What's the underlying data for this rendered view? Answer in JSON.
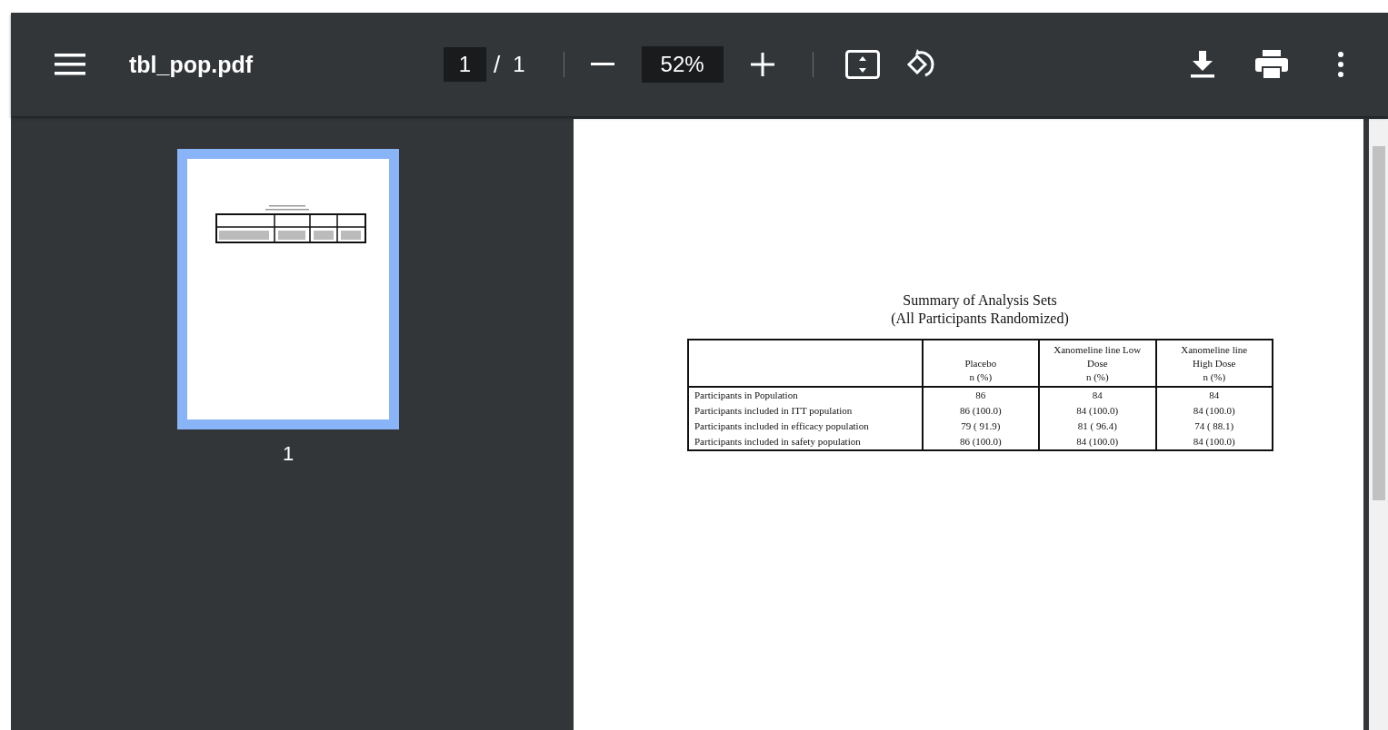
{
  "toolbar": {
    "title": "tbl_pop.pdf",
    "page_current": "1",
    "page_separator": "/",
    "page_total": "1",
    "zoom": "52%"
  },
  "sidebar": {
    "thumbnails": [
      {
        "label": "1",
        "selected": true
      }
    ]
  },
  "document": {
    "title_lines": [
      "Summary of Analysis Sets",
      "(All Participants Randomized)"
    ],
    "table": {
      "columns": [
        {
          "lines": [
            "Placebo",
            "n (%)"
          ]
        },
        {
          "lines": [
            "Xanomeline line Low",
            "Dose",
            "n (%)"
          ]
        },
        {
          "lines": [
            "Xanomeline line",
            "High Dose",
            "n (%)"
          ]
        }
      ],
      "rows": [
        {
          "label": "Participants in Population",
          "cells": [
            "86",
            "84",
            "84"
          ]
        },
        {
          "label": "Participants included in ITT population",
          "cells": [
            "86 (100.0)",
            "84 (100.0)",
            "84 (100.0)"
          ]
        },
        {
          "label": "Participants included in efficacy population",
          "cells": [
            "79 ( 91.9)",
            "81 ( 96.4)",
            "74 ( 88.1)"
          ]
        },
        {
          "label": "Participants included in safety population",
          "cells": [
            "86 (100.0)",
            "84 (100.0)",
            "84 (100.0)"
          ]
        }
      ]
    }
  }
}
